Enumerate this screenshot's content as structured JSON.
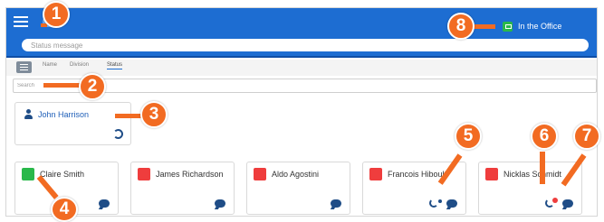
{
  "topbar": {
    "status_placeholder": "Status message",
    "presence_label": "In the Office",
    "presence_color": "#29b84a",
    "accent_color": "#1d6dd2"
  },
  "sortbar": {
    "tabs": [
      "Name",
      "Division",
      "Status"
    ],
    "active": "Status"
  },
  "search": {
    "placeholder": "Search"
  },
  "self": {
    "name": "John Harrison"
  },
  "contacts": [
    {
      "name": "Claire Smith",
      "status_icon": "presence-icon",
      "status_color": "#29b84a"
    },
    {
      "name": "James Richardson",
      "status_icon": "flight-icon",
      "status_color": "#ef3d3d"
    },
    {
      "name": "Aldo Agostini",
      "status_icon": "meeting-icon",
      "status_color": "#ef3d3d"
    },
    {
      "name": "Francois Hiboult",
      "status_icon": "restaurant-icon",
      "status_color": "#ef3d3d"
    },
    {
      "name": "Nicklas Schmidt",
      "status_icon": "do-not-disturb-icon",
      "status_color": "#ef3d3d"
    }
  ],
  "callouts": [
    "1",
    "2",
    "3",
    "4",
    "5",
    "6",
    "7",
    "8"
  ]
}
